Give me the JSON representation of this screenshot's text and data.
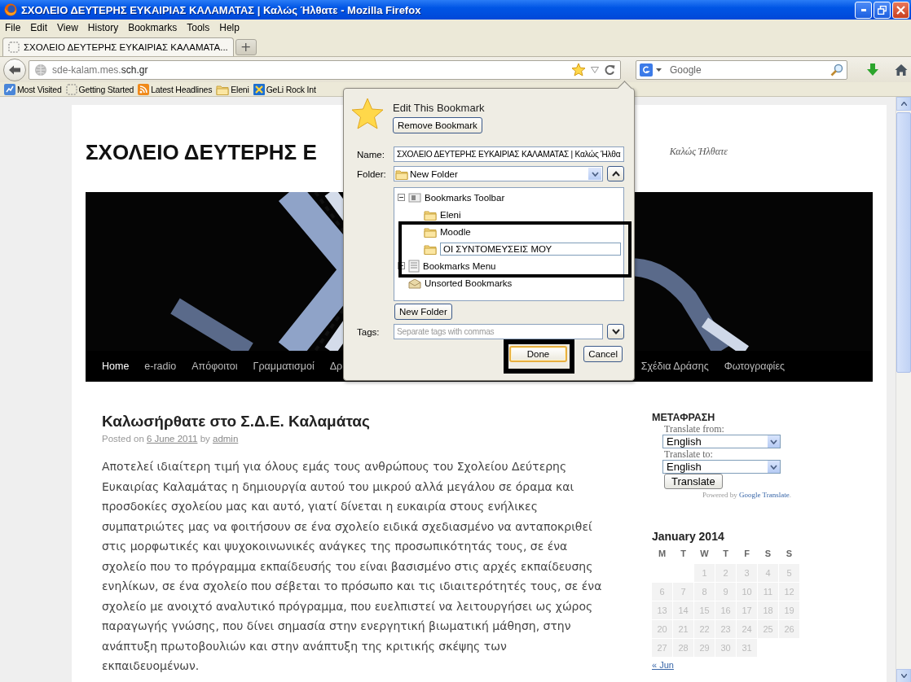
{
  "window": {
    "title": "ΣΧΟΛΕΙΟ ΔΕΥΤΕΡΗΣ ΕΥΚΑΙΡΙΑΣ ΚΑΛΑΜΑΤΑΣ | Καλώς Ήλθατε - Mozilla Firefox"
  },
  "menu": [
    "File",
    "Edit",
    "View",
    "History",
    "Bookmarks",
    "Tools",
    "Help"
  ],
  "tabs": [
    {
      "label": "ΣΧΟΛΕΙΟ ΔΕΥΤΕΡΗΣ ΕΥΚΑΙΡΙΑΣ ΚΑΛΑΜΑΤΑ...",
      "selected": true
    }
  ],
  "new_tab": "+",
  "address": {
    "url": "sde-kalam.mes.**sch.gr**",
    "bookmarked": true
  },
  "search": {
    "placeholder": "Google"
  },
  "bookmarks_bar": [
    {
      "label": "Most Visited",
      "kind": "smart"
    },
    {
      "label": "Getting Started",
      "kind": "page"
    },
    {
      "label": "Latest Headlines",
      "kind": "rss"
    },
    {
      "label": "Eleni",
      "kind": "folder"
    },
    {
      "label": "GeLi Rock Int",
      "kind": "app"
    }
  ],
  "page": {
    "site_title": "ΣΧΟΛΕΙΟ ΔΕΥΤΕΡΗΣ Ε",
    "tagline": "Καλώς Ήλθατε",
    "nav_left": [
      {
        "label": "Home",
        "selected": true
      },
      {
        "label": "e-radio",
        "selected": false
      },
      {
        "label": "Απόφοιτοι",
        "selected": false
      },
      {
        "label": "Γραμματισμοί",
        "selected": false
      },
      {
        "label": "Δρ",
        "selected": false
      }
    ],
    "nav_right": [
      {
        "label": "Σχέδια Δράσης",
        "selected": false
      },
      {
        "label": "Φωτογραφίες",
        "selected": false
      }
    ],
    "post": {
      "title": "Καλωσήρθατε στο Σ.Δ.Ε. Καλαμάτας",
      "meta_prefix": "Posted on",
      "date": "6 June 2011",
      "meta_middle": "by",
      "author": "admin",
      "body": "Αποτελεί ιδιαίτερη τιμή για όλους εμάς τους ανθρώπους του Σχολείου Δεύτερης Ευκαιρίας Καλαμάτας η δημιουργία αυτού του μικρού αλλά μεγάλου σε όραμα και προσδοκίες σχολείου μας και αυτό, γιατί δίνεται η ευκαιρία στους ενήλικες συμπατριώτες μας να φοιτήσουν σε ένα σχολείο ειδικά σχεδιασμένο να ανταποκριθεί στις μορφωτικές και ψυχοκοινωνικές ανάγκες της προσωπικότητάς τους, σε ένα σχολείο που το πρόγραμμα εκπαίδευσής του είναι βασισμένο στις αρχές εκπαίδευσης ενηλίκων, σε ένα σχολείο που σέβεται το πρόσωπο και τις ιδιαιτερότητές τους, σε ένα σχολείο με ανοιχτό αναλυτικό πρόγραμμα, που ευελπιστεί να λειτουργήσει ως χώρος παραγωγής γνώσης, που δίνει σημασία στην ενεργητική βιωματική μάθηση, στην ανάπτυξη πρωτοβουλιών και στην ανάπτυξη της κριτικής σκέψης των εκπαιδευομένων."
    },
    "translate": {
      "title": "ΜΕΤΑΦΡΑΣΗ",
      "from_label": "Translate from:",
      "from_value": "English",
      "to_label": "Translate to:",
      "to_value": "English",
      "button": "Translate",
      "powered_prefix": "Powered by",
      "powered_link": "Google Translate",
      "powered_suffix": "."
    },
    "calendar": {
      "title": "January 2014",
      "weekdays": [
        "M",
        "T",
        "W",
        "T",
        "F",
        "S",
        "S"
      ],
      "weeks": [
        [
          "1",
          "2",
          "3",
          "4",
          "5"
        ],
        [
          "6",
          "7",
          "8",
          "9",
          "10",
          "11",
          "12"
        ],
        [
          "13",
          "14",
          "15",
          "16",
          "17",
          "18",
          "19"
        ],
        [
          "20",
          "21",
          "22",
          "23",
          "24",
          "25",
          "26"
        ],
        [
          "27",
          "28",
          "29",
          "30",
          "31"
        ]
      ],
      "prev_link": "« Jun"
    }
  },
  "bookmark_panel": {
    "title": "Edit This Bookmark",
    "remove_button": "Remove Bookmark",
    "name_label": "Name:",
    "name_value": "ΣΧΟΛΕΙΟ ΔΕΥΤΕΡΗΣ ΕΥΚΑΙΡΙΑΣ ΚΑΛΑΜΑΤΑΣ | Καλώς Ήλθα",
    "folder_label": "Folder:",
    "folder_value": "New Folder",
    "tree": [
      {
        "label": "Bookmarks Toolbar",
        "kind": "toolbar",
        "expanded": true,
        "children": [
          {
            "label": "Eleni",
            "kind": "folder",
            "editing": false
          },
          {
            "label": "Moodle",
            "kind": "folder",
            "editing": false
          },
          {
            "label": "ΟΙ ΣΥΝΤΟΜΕΥΣΕΙΣ ΜΟΥ",
            "kind": "folder",
            "editing": true
          }
        ]
      },
      {
        "label": "Bookmarks Menu",
        "kind": "menu",
        "expanded": false
      },
      {
        "label": "Unsorted Bookmarks",
        "kind": "unsorted"
      }
    ],
    "new_folder_button": "New Folder",
    "tags_label": "Tags:",
    "tags_placeholder": "Separate tags with commas",
    "buttons": [
      {
        "label": "Done",
        "default": true
      },
      {
        "label": "Cancel",
        "default": false
      }
    ]
  }
}
